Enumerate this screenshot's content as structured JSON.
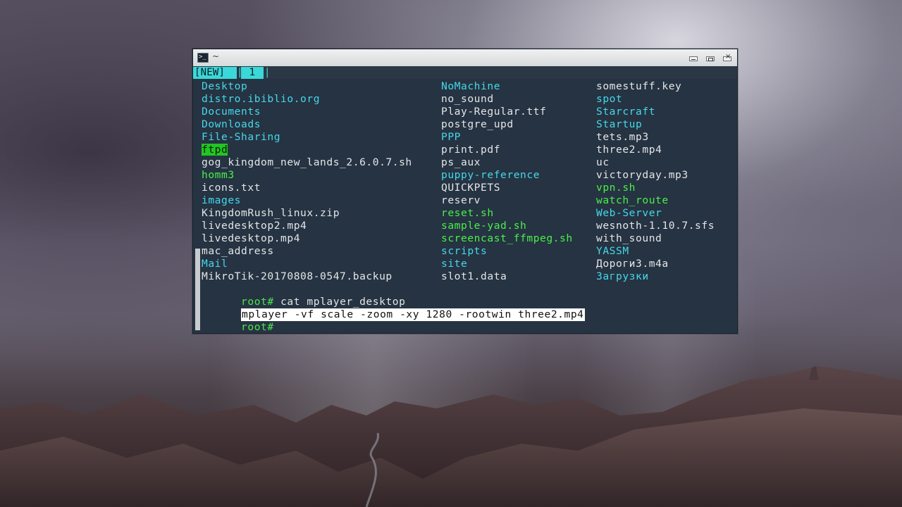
{
  "window": {
    "title": "~",
    "icon": "terminal-icon",
    "controls": [
      "minimize-icon",
      "maximize-icon",
      "close-icon"
    ]
  },
  "tabs": [
    {
      "label": "[NEW]"
    },
    {
      "label": "1"
    }
  ],
  "listing": {
    "col1": [
      {
        "name": "Desktop",
        "kind": "dir"
      },
      {
        "name": "distro.ibiblio.org",
        "kind": "dir"
      },
      {
        "name": "Documents",
        "kind": "dir"
      },
      {
        "name": "Downloads",
        "kind": "dir"
      },
      {
        "name": "File-Sharing",
        "kind": "dir"
      },
      {
        "name": "ftpd",
        "kind": "highlight"
      },
      {
        "name": "gog_kingdom_new_lands_2.6.0.7.sh",
        "kind": "file"
      },
      {
        "name": "homm3",
        "kind": "exec"
      },
      {
        "name": "icons.txt",
        "kind": "file"
      },
      {
        "name": "images",
        "kind": "dir"
      },
      {
        "name": "KingdomRush_linux.zip",
        "kind": "file"
      },
      {
        "name": "livedesktop2.mp4",
        "kind": "file"
      },
      {
        "name": "livedesktop.mp4",
        "kind": "file"
      },
      {
        "name": "mac_address",
        "kind": "file"
      },
      {
        "name": "Mail",
        "kind": "dir"
      },
      {
        "name": "MikroTik-20170808-0547.backup",
        "kind": "file"
      }
    ],
    "col2": [
      {
        "name": "NoMachine",
        "kind": "dir"
      },
      {
        "name": "no_sound",
        "kind": "file"
      },
      {
        "name": "Play-Regular.ttf",
        "kind": "file"
      },
      {
        "name": "postgre_upd",
        "kind": "file"
      },
      {
        "name": "PPP",
        "kind": "dir"
      },
      {
        "name": "print.pdf",
        "kind": "file"
      },
      {
        "name": "ps_aux",
        "kind": "file"
      },
      {
        "name": "puppy-reference",
        "kind": "dir"
      },
      {
        "name": "QUICKPETS",
        "kind": "file"
      },
      {
        "name": "reserv",
        "kind": "file"
      },
      {
        "name": "reset.sh",
        "kind": "exec"
      },
      {
        "name": "sample-yad.sh",
        "kind": "exec"
      },
      {
        "name": "screencast_ffmpeg.sh",
        "kind": "exec"
      },
      {
        "name": "scripts",
        "kind": "dir"
      },
      {
        "name": "site",
        "kind": "dir"
      },
      {
        "name": "slot1.data",
        "kind": "file"
      }
    ],
    "col3": [
      {
        "name": "somestuff.key",
        "kind": "file"
      },
      {
        "name": "spot",
        "kind": "dir"
      },
      {
        "name": "Starcraft",
        "kind": "dir"
      },
      {
        "name": "Startup",
        "kind": "dir"
      },
      {
        "name": "tets.mp3",
        "kind": "file"
      },
      {
        "name": "three2.mp4",
        "kind": "file"
      },
      {
        "name": "uc",
        "kind": "file"
      },
      {
        "name": "victoryday.mp3",
        "kind": "file"
      },
      {
        "name": "vpn.sh",
        "kind": "exec"
      },
      {
        "name": "watch_route",
        "kind": "exec"
      },
      {
        "name": "Web-Server",
        "kind": "dir"
      },
      {
        "name": "wesnoth-1.10.7.sfs",
        "kind": "file"
      },
      {
        "name": "with_sound",
        "kind": "file"
      },
      {
        "name": "YASSM",
        "kind": "dir"
      },
      {
        "name": "Дороги3.m4a",
        "kind": "file"
      },
      {
        "name": "Загрузки",
        "kind": "dir"
      }
    ]
  },
  "session": {
    "prompt": "root#",
    "command": "cat mplayer_desktop",
    "output": "mplayer -vf scale -zoom -xy 1280 -rootwin three2.mp4",
    "prompt2": "root#"
  },
  "colors": {
    "terminal_bg": "#263342",
    "directory": "#45d8ea",
    "file": "#e3e6e8",
    "executable": "#49f04a",
    "tab_accent": "#3ad8d8"
  }
}
